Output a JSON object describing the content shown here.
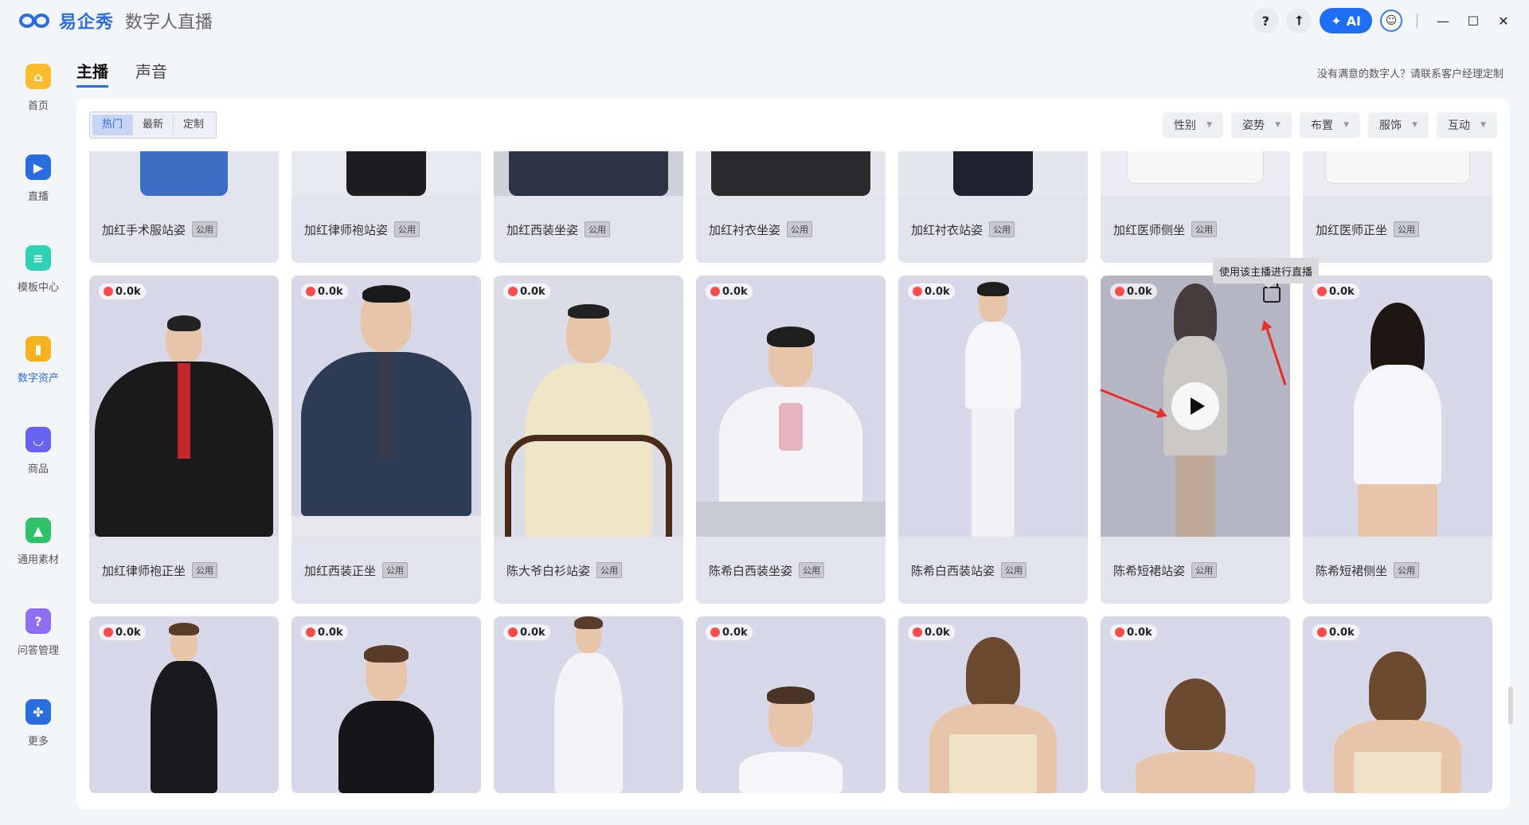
{
  "app": {
    "brand": "易企秀",
    "subtitle": "数字人直播",
    "ai_label": "AI",
    "help_label": "?",
    "upload_label": "⭡",
    "avatar_glyph": "☺",
    "minimize": "—",
    "maximize": "☐",
    "close": "✕"
  },
  "sidebar": {
    "items": [
      {
        "label": "首页",
        "icon": "home-icon",
        "color": "#fbbd2e",
        "glyph": "⌂",
        "active": false
      },
      {
        "label": "直播",
        "icon": "video-icon",
        "color": "#2a6de0",
        "glyph": "▶",
        "active": false
      },
      {
        "label": "模板中心",
        "icon": "template-icon",
        "color": "#2fd0b4",
        "glyph": "≡",
        "active": false
      },
      {
        "label": "数字资产",
        "icon": "assets-icon",
        "color": "#f5b21c",
        "glyph": "▮",
        "active": true
      },
      {
        "label": "商品",
        "icon": "bag-icon",
        "color": "#6a62f0",
        "glyph": "◡",
        "active": false
      },
      {
        "label": "通用素材",
        "icon": "image-icon",
        "color": "#2fc26a",
        "glyph": "▲",
        "active": false
      },
      {
        "label": "问答管理",
        "icon": "question-icon",
        "color": "#8e6ef2",
        "glyph": "?",
        "active": false
      },
      {
        "label": "更多",
        "icon": "more-icon",
        "color": "#2a6de0",
        "glyph": "✤",
        "active": false
      }
    ]
  },
  "tabs": [
    {
      "label": "主播",
      "active": true
    },
    {
      "label": "声音",
      "active": false
    }
  ],
  "custom_note": "没有满意的数字人？请联系客户经理定制",
  "filter": {
    "segments": [
      {
        "label": "热门",
        "active": true
      },
      {
        "label": "最新",
        "active": false
      },
      {
        "label": "定制",
        "active": false
      }
    ],
    "dropdowns": [
      "性别",
      "姿势",
      "布置",
      "服饰",
      "互动"
    ],
    "caret": "▼"
  },
  "tag_label": "公用",
  "hot_count": "0.0k",
  "tooltip": "使用该主播进行直播",
  "cards": {
    "row1": [
      "加红手术服站姿",
      "加红律师袍站姿",
      "加红西装坐姿",
      "加红衬衣坐姿",
      "加红衬衣站姿",
      "加红医师侧坐",
      "加红医师正坐"
    ],
    "row2": [
      "加红律师袍正坐",
      "加红西装正坐",
      "陈大爷白衫站姿",
      "陈希白西装坐姿",
      "陈希白西装站姿",
      "陈希短裙站姿",
      "陈希短裙侧坐"
    ]
  },
  "colors": {
    "accent": "#2a6de0",
    "arrow": "#e8302a",
    "fire": "#ff4c4c"
  }
}
